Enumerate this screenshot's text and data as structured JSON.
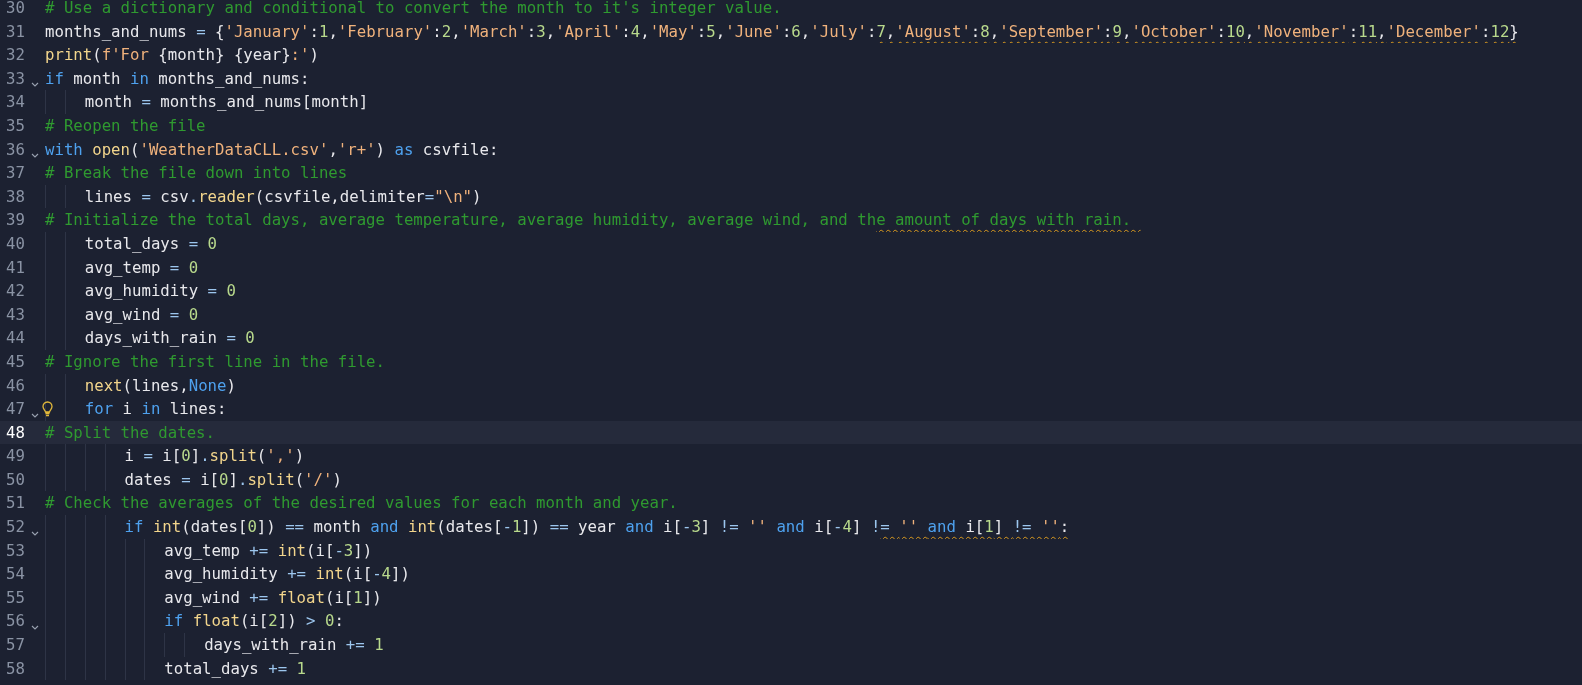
{
  "editor": {
    "lines": [
      {
        "number": "30",
        "selected": false,
        "foldable": false,
        "lightbulb": false,
        "tokens": [
          {
            "kind": "comment",
            "text": "# Use a dictionary and conditional to convert the month to it's integer value."
          }
        ]
      },
      {
        "number": "31",
        "selected": false,
        "foldable": false,
        "lightbulb": false,
        "tokens": [
          {
            "kind": "plain",
            "text": "months_and_nums "
          },
          {
            "kind": "operator",
            "text": "="
          },
          {
            "kind": "plain",
            "text": " {"
          },
          {
            "kind": "string",
            "text": "'January'"
          },
          {
            "kind": "plain",
            "text": ":"
          },
          {
            "kind": "number",
            "text": "1"
          },
          {
            "kind": "plain",
            "text": ","
          },
          {
            "kind": "string",
            "text": "'February'"
          },
          {
            "kind": "plain",
            "text": ":"
          },
          {
            "kind": "number",
            "text": "2"
          },
          {
            "kind": "plain",
            "text": ","
          },
          {
            "kind": "string",
            "text": "'March'"
          },
          {
            "kind": "plain",
            "text": ":"
          },
          {
            "kind": "number",
            "text": "3"
          },
          {
            "kind": "plain",
            "text": ","
          },
          {
            "kind": "string",
            "text": "'April'"
          },
          {
            "kind": "plain",
            "text": ":"
          },
          {
            "kind": "number",
            "text": "4"
          },
          {
            "kind": "plain",
            "text": ","
          },
          {
            "kind": "string",
            "text": "'May'"
          },
          {
            "kind": "plain",
            "text": ":"
          },
          {
            "kind": "number",
            "text": "5"
          },
          {
            "kind": "plain",
            "text": ","
          },
          {
            "kind": "string",
            "text": "'June'"
          },
          {
            "kind": "plain",
            "text": ":"
          },
          {
            "kind": "number",
            "text": "6"
          },
          {
            "kind": "plain",
            "text": ","
          },
          {
            "kind": "string",
            "text": "'July'"
          },
          {
            "kind": "plain",
            "text": ":"
          }
        ],
        "squiggled_tokens": [
          {
            "kind": "number",
            "text": "7"
          },
          {
            "kind": "plain",
            "text": ","
          },
          {
            "kind": "string",
            "text": "'August'"
          },
          {
            "kind": "plain",
            "text": ":"
          },
          {
            "kind": "number",
            "text": "8"
          },
          {
            "kind": "plain",
            "text": ","
          },
          {
            "kind": "string",
            "text": "'September'"
          },
          {
            "kind": "plain",
            "text": ":"
          },
          {
            "kind": "number",
            "text": "9"
          },
          {
            "kind": "plain",
            "text": ","
          },
          {
            "kind": "string",
            "text": "'October'"
          },
          {
            "kind": "plain",
            "text": ":"
          },
          {
            "kind": "number",
            "text": "10"
          },
          {
            "kind": "plain",
            "text": ","
          },
          {
            "kind": "string",
            "text": "'November'"
          },
          {
            "kind": "plain",
            "text": ":"
          },
          {
            "kind": "number",
            "text": "11"
          },
          {
            "kind": "plain",
            "text": ","
          },
          {
            "kind": "string",
            "text": "'December'"
          },
          {
            "kind": "plain",
            "text": ":"
          },
          {
            "kind": "number",
            "text": "12"
          },
          {
            "kind": "plain",
            "text": "}"
          }
        ]
      },
      {
        "number": "32",
        "selected": false,
        "foldable": false,
        "lightbulb": false,
        "tokens": [
          {
            "kind": "function",
            "text": "print"
          },
          {
            "kind": "plain",
            "text": "("
          },
          {
            "kind": "string",
            "text": "f'For "
          },
          {
            "kind": "plain",
            "text": "{month} {year}"
          },
          {
            "kind": "string",
            "text": ":'"
          },
          {
            "kind": "plain",
            "text": ")"
          }
        ]
      },
      {
        "number": "33",
        "selected": false,
        "foldable": true,
        "lightbulb": false,
        "tokens": [
          {
            "kind": "keyword",
            "text": "if"
          },
          {
            "kind": "plain",
            "text": " month "
          },
          {
            "kind": "keyword",
            "text": "in"
          },
          {
            "kind": "plain",
            "text": " months_and_nums:"
          }
        ]
      },
      {
        "number": "34",
        "selected": false,
        "foldable": false,
        "lightbulb": false,
        "tokens": [
          {
            "kind": "plain",
            "text": "    month "
          },
          {
            "kind": "operator",
            "text": "="
          },
          {
            "kind": "plain",
            "text": " months_and_nums[month]"
          }
        ]
      },
      {
        "number": "35",
        "selected": false,
        "foldable": false,
        "lightbulb": false,
        "tokens": [
          {
            "kind": "comment",
            "text": "# Reopen the file"
          }
        ]
      },
      {
        "number": "36",
        "selected": false,
        "foldable": true,
        "lightbulb": false,
        "tokens": [
          {
            "kind": "keyword",
            "text": "with "
          },
          {
            "kind": "function",
            "text": "open"
          },
          {
            "kind": "plain",
            "text": "("
          },
          {
            "kind": "string",
            "text": "'WeatherDataCLL.csv'"
          },
          {
            "kind": "plain",
            "text": ","
          },
          {
            "kind": "string",
            "text": "'r+'"
          },
          {
            "kind": "plain",
            "text": ") "
          },
          {
            "kind": "keyword",
            "text": "as"
          },
          {
            "kind": "plain",
            "text": " csvfile:"
          }
        ]
      },
      {
        "number": "37",
        "selected": false,
        "foldable": false,
        "lightbulb": false,
        "tokens": [
          {
            "kind": "comment",
            "text": "# Break the file down into lines"
          }
        ]
      },
      {
        "number": "38",
        "selected": false,
        "foldable": false,
        "lightbulb": false,
        "tokens": [
          {
            "kind": "plain",
            "text": "    lines "
          },
          {
            "kind": "operator",
            "text": "="
          },
          {
            "kind": "plain",
            "text": " csv"
          },
          {
            "kind": "operator",
            "text": "."
          },
          {
            "kind": "function",
            "text": "reader"
          },
          {
            "kind": "plain",
            "text": "(csvfile,delimiter"
          },
          {
            "kind": "operator",
            "text": "="
          },
          {
            "kind": "string",
            "text": "\"\\n\""
          },
          {
            "kind": "plain",
            "text": ")"
          }
        ]
      },
      {
        "number": "39",
        "selected": false,
        "foldable": false,
        "lightbulb": false,
        "tokens": [
          {
            "kind": "comment",
            "text": "# Initialize the total days, average temperature, average humidity, average wind, and th"
          }
        ],
        "squiggled_tokens": [
          {
            "kind": "comment",
            "text": "e amount of days with rain. "
          }
        ]
      },
      {
        "number": "40",
        "selected": false,
        "foldable": false,
        "lightbulb": false,
        "tokens": [
          {
            "kind": "plain",
            "text": "    total_days "
          },
          {
            "kind": "operator",
            "text": "= "
          },
          {
            "kind": "number",
            "text": "0"
          }
        ]
      },
      {
        "number": "41",
        "selected": false,
        "foldable": false,
        "lightbulb": false,
        "tokens": [
          {
            "kind": "plain",
            "text": "    avg_temp "
          },
          {
            "kind": "operator",
            "text": "= "
          },
          {
            "kind": "number",
            "text": "0"
          }
        ]
      },
      {
        "number": "42",
        "selected": false,
        "foldable": false,
        "lightbulb": false,
        "tokens": [
          {
            "kind": "plain",
            "text": "    avg_humidity "
          },
          {
            "kind": "operator",
            "text": "= "
          },
          {
            "kind": "number",
            "text": "0"
          }
        ]
      },
      {
        "number": "43",
        "selected": false,
        "foldable": false,
        "lightbulb": false,
        "tokens": [
          {
            "kind": "plain",
            "text": "    avg_wind "
          },
          {
            "kind": "operator",
            "text": "= "
          },
          {
            "kind": "number",
            "text": "0"
          }
        ]
      },
      {
        "number": "44",
        "selected": false,
        "foldable": false,
        "lightbulb": false,
        "tokens": [
          {
            "kind": "plain",
            "text": "    days_with_rain "
          },
          {
            "kind": "operator",
            "text": "= "
          },
          {
            "kind": "number",
            "text": "0"
          }
        ]
      },
      {
        "number": "45",
        "selected": false,
        "foldable": false,
        "lightbulb": false,
        "tokens": [
          {
            "kind": "comment",
            "text": "# Ignore the first line in the file."
          }
        ]
      },
      {
        "number": "46",
        "selected": false,
        "foldable": false,
        "lightbulb": false,
        "tokens": [
          {
            "kind": "function",
            "text": "    next"
          },
          {
            "kind": "plain",
            "text": "(lines,"
          },
          {
            "kind": "constant",
            "text": "None"
          },
          {
            "kind": "plain",
            "text": ")"
          }
        ]
      },
      {
        "number": "47",
        "selected": false,
        "foldable": true,
        "lightbulb": true,
        "tokens": [
          {
            "kind": "keyword",
            "text": "    for"
          },
          {
            "kind": "plain",
            "text": " i "
          },
          {
            "kind": "keyword",
            "text": "in"
          },
          {
            "kind": "plain",
            "text": " lines:"
          }
        ]
      },
      {
        "number": "48",
        "selected": true,
        "foldable": false,
        "lightbulb": false,
        "tokens": [
          {
            "kind": "comment",
            "text": "# Split the dates."
          }
        ]
      },
      {
        "number": "49",
        "selected": false,
        "foldable": false,
        "lightbulb": false,
        "tokens": [
          {
            "kind": "plain",
            "text": "        i "
          },
          {
            "kind": "operator",
            "text": "="
          },
          {
            "kind": "plain",
            "text": " i["
          },
          {
            "kind": "number",
            "text": "0"
          },
          {
            "kind": "plain",
            "text": "]"
          },
          {
            "kind": "operator",
            "text": "."
          },
          {
            "kind": "function",
            "text": "split"
          },
          {
            "kind": "plain",
            "text": "("
          },
          {
            "kind": "string",
            "text": "','"
          },
          {
            "kind": "plain",
            "text": ")"
          }
        ]
      },
      {
        "number": "50",
        "selected": false,
        "foldable": false,
        "lightbulb": false,
        "tokens": [
          {
            "kind": "plain",
            "text": "        dates "
          },
          {
            "kind": "operator",
            "text": "="
          },
          {
            "kind": "plain",
            "text": " i["
          },
          {
            "kind": "number",
            "text": "0"
          },
          {
            "kind": "plain",
            "text": "]"
          },
          {
            "kind": "operator",
            "text": "."
          },
          {
            "kind": "function",
            "text": "split"
          },
          {
            "kind": "plain",
            "text": "("
          },
          {
            "kind": "string",
            "text": "'/'"
          },
          {
            "kind": "plain",
            "text": ")"
          }
        ]
      },
      {
        "number": "51",
        "selected": false,
        "foldable": false,
        "lightbulb": false,
        "tokens": [
          {
            "kind": "comment",
            "text": "# Check the averages of the desired values for each month and year."
          }
        ]
      },
      {
        "number": "52",
        "selected": false,
        "foldable": true,
        "lightbulb": false,
        "tokens": [
          {
            "kind": "keyword",
            "text": "        if "
          },
          {
            "kind": "function",
            "text": "int"
          },
          {
            "kind": "plain",
            "text": "(dates["
          },
          {
            "kind": "number",
            "text": "0"
          },
          {
            "kind": "plain",
            "text": "]) "
          },
          {
            "kind": "operator",
            "text": "=="
          },
          {
            "kind": "plain",
            "text": " month "
          },
          {
            "kind": "keyword",
            "text": "and "
          },
          {
            "kind": "function",
            "text": "int"
          },
          {
            "kind": "plain",
            "text": "(dates["
          },
          {
            "kind": "operator",
            "text": "-"
          },
          {
            "kind": "number",
            "text": "1"
          },
          {
            "kind": "plain",
            "text": "]) "
          },
          {
            "kind": "operator",
            "text": "=="
          },
          {
            "kind": "plain",
            "text": " year "
          },
          {
            "kind": "keyword",
            "text": "and"
          },
          {
            "kind": "plain",
            "text": " i["
          },
          {
            "kind": "operator",
            "text": "-"
          },
          {
            "kind": "number",
            "text": "3"
          },
          {
            "kind": "plain",
            "text": "] "
          },
          {
            "kind": "operator",
            "text": "!= "
          },
          {
            "kind": "string",
            "text": "'' "
          },
          {
            "kind": "keyword",
            "text": "and"
          },
          {
            "kind": "plain",
            "text": " i["
          },
          {
            "kind": "operator",
            "text": "-"
          },
          {
            "kind": "number",
            "text": "4"
          },
          {
            "kind": "plain",
            "text": "] "
          },
          {
            "kind": "operator",
            "text": "!"
          }
        ],
        "squiggled_tokens": [
          {
            "kind": "operator",
            "text": "= "
          },
          {
            "kind": "string",
            "text": "'' "
          },
          {
            "kind": "keyword",
            "text": "and"
          },
          {
            "kind": "plain",
            "text": " i["
          },
          {
            "kind": "number",
            "text": "1"
          },
          {
            "kind": "plain",
            "text": "] "
          },
          {
            "kind": "operator",
            "text": "!= "
          },
          {
            "kind": "string",
            "text": "''"
          },
          {
            "kind": "plain",
            "text": ":"
          }
        ]
      },
      {
        "number": "53",
        "selected": false,
        "foldable": false,
        "lightbulb": false,
        "tokens": [
          {
            "kind": "plain",
            "text": "            avg_temp "
          },
          {
            "kind": "operator",
            "text": "+= "
          },
          {
            "kind": "function",
            "text": "int"
          },
          {
            "kind": "plain",
            "text": "(i["
          },
          {
            "kind": "operator",
            "text": "-"
          },
          {
            "kind": "number",
            "text": "3"
          },
          {
            "kind": "plain",
            "text": "])"
          }
        ]
      },
      {
        "number": "54",
        "selected": false,
        "foldable": false,
        "lightbulb": false,
        "tokens": [
          {
            "kind": "plain",
            "text": "            avg_humidity "
          },
          {
            "kind": "operator",
            "text": "+= "
          },
          {
            "kind": "function",
            "text": "int"
          },
          {
            "kind": "plain",
            "text": "(i["
          },
          {
            "kind": "operator",
            "text": "-"
          },
          {
            "kind": "number",
            "text": "4"
          },
          {
            "kind": "plain",
            "text": "])"
          }
        ]
      },
      {
        "number": "55",
        "selected": false,
        "foldable": false,
        "lightbulb": false,
        "tokens": [
          {
            "kind": "plain",
            "text": "            avg_wind "
          },
          {
            "kind": "operator",
            "text": "+= "
          },
          {
            "kind": "function",
            "text": "float"
          },
          {
            "kind": "plain",
            "text": "(i["
          },
          {
            "kind": "number",
            "text": "1"
          },
          {
            "kind": "plain",
            "text": "])"
          }
        ]
      },
      {
        "number": "56",
        "selected": false,
        "foldable": true,
        "lightbulb": false,
        "tokens": [
          {
            "kind": "keyword",
            "text": "            if "
          },
          {
            "kind": "function",
            "text": "float"
          },
          {
            "kind": "plain",
            "text": "(i["
          },
          {
            "kind": "number",
            "text": "2"
          },
          {
            "kind": "plain",
            "text": "]) "
          },
          {
            "kind": "operator",
            "text": "> "
          },
          {
            "kind": "number",
            "text": "0"
          },
          {
            "kind": "plain",
            "text": ":"
          }
        ]
      },
      {
        "number": "57",
        "selected": false,
        "foldable": false,
        "lightbulb": false,
        "tokens": [
          {
            "kind": "plain",
            "text": "                days_with_rain "
          },
          {
            "kind": "operator",
            "text": "+= "
          },
          {
            "kind": "number",
            "text": "1"
          }
        ]
      },
      {
        "number": "58",
        "selected": false,
        "foldable": false,
        "lightbulb": false,
        "tokens": [
          {
            "kind": "plain",
            "text": "            total_days "
          },
          {
            "kind": "operator",
            "text": "+= "
          },
          {
            "kind": "number",
            "text": "1"
          }
        ]
      }
    ]
  }
}
